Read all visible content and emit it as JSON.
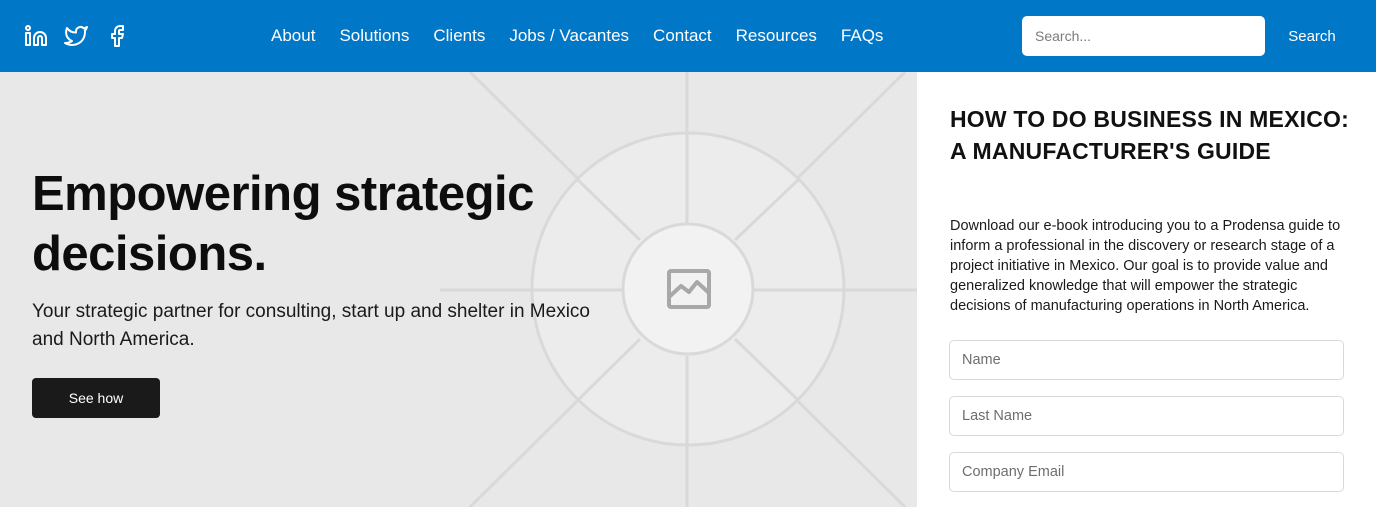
{
  "header": {
    "social": [
      {
        "name": "linkedin",
        "icon": "linkedin-icon"
      },
      {
        "name": "twitter",
        "icon": "twitter-icon"
      },
      {
        "name": "facebook",
        "icon": "facebook-icon"
      }
    ],
    "nav": [
      "About",
      "Solutions",
      "Clients",
      "Jobs / Vacantes",
      "Contact",
      "Resources",
      "FAQs"
    ],
    "search": {
      "placeholder": "Search...",
      "button_label": "Search"
    },
    "background_color": "#0177c8"
  },
  "hero": {
    "title": "Empowering strategic decisions.",
    "subtitle": "Your strategic partner for consulting, start up and shelter in Mexico and North America.",
    "cta_label": "See how",
    "background_icon": "image-placeholder-icon"
  },
  "side_panel": {
    "title": "HOW TO DO BUSINESS IN MEXICO: A MANUFACTURER'S GUIDE",
    "description": "Download our e-book introducing you to a Prodensa guide to inform a professional in the discovery or research stage of a project initiative in Mexico. Our goal is to provide value and generalized knowledge that will empower the strategic decisions of manufacturing operations in North America.",
    "fields": {
      "name_placeholder": "Name",
      "last_name_placeholder": "Last Name",
      "email_placeholder": "Company Email"
    }
  }
}
